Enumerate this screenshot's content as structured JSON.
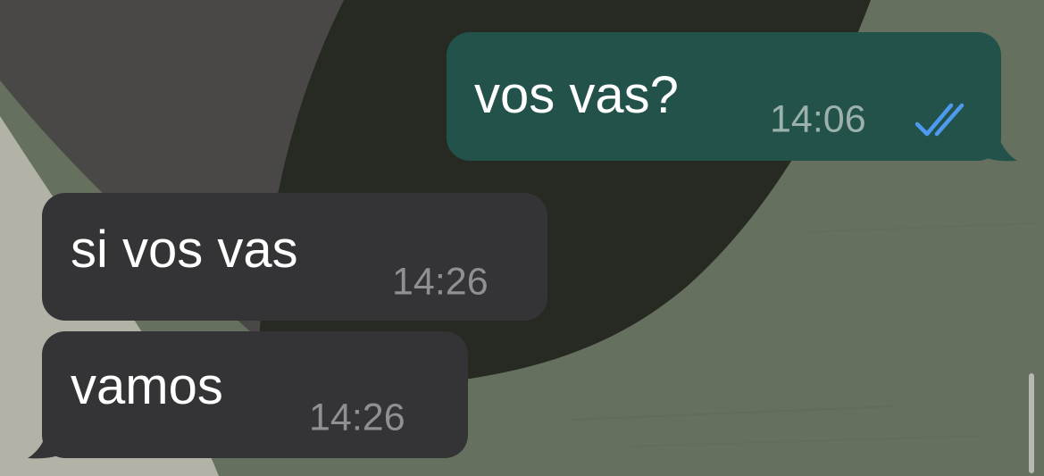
{
  "chat": {
    "messages": [
      {
        "direction": "outgoing",
        "text": "vos vas?",
        "time": "14:06",
        "status_icon": "double-check-read-icon"
      },
      {
        "direction": "incoming",
        "text": "si vos vas",
        "time": "14:26"
      },
      {
        "direction": "incoming",
        "text": "vamos",
        "time": "14:26"
      }
    ]
  },
  "colors": {
    "outgoing_bubble": "#22524a",
    "incoming_bubble": "#343436",
    "read_receipt": "#4d9af0",
    "message_text": "#ffffff",
    "wallpaper_dark": "#262a22",
    "wallpaper_green": "#6a7460",
    "wallpaper_beige": "#b2b2a7",
    "wallpaper_brown": "#4a4846"
  }
}
